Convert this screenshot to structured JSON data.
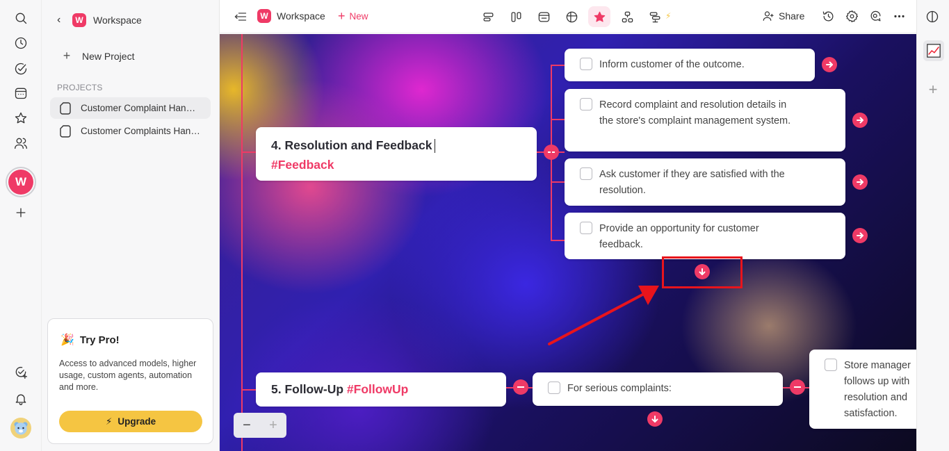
{
  "sidebar": {
    "workspace_name": "Workspace",
    "new_project_label": "New Project",
    "projects_heading": "PROJECTS",
    "projects": [
      {
        "name": "Customer Complaint Handling",
        "active": true
      },
      {
        "name": "Customer Complaints Handling",
        "active": false
      }
    ],
    "pro_card": {
      "title": "Try Pro!",
      "description": "Access to advanced models, higher usage, custom agents, automation and more.",
      "button_label": "Upgrade"
    }
  },
  "rail": {
    "workspace_avatar_letter": "W"
  },
  "topbar": {
    "workspace_name": "Workspace",
    "logo_letter": "W",
    "new_label": "New",
    "share_label": "Share"
  },
  "canvas": {
    "section4": {
      "title": "4. Resolution and Feedback",
      "tag": "#Feedback",
      "tasks": [
        "Inform customer of the outcome.",
        "Record complaint and resolution details in the store's complaint management system.",
        "Ask customer if they are satisfied with the resolution.",
        "Provide an opportunity for customer feedback."
      ]
    },
    "section5": {
      "title": "5. Follow-Up",
      "tag": "#FollowUp",
      "task": "For serious complaints:",
      "subtask": "Store manager follows up with resolution and satisfaction."
    },
    "zoom_out_label": "−",
    "zoom_in_label": "+"
  },
  "colors": {
    "accent": "#ef3a66",
    "highlight_box": "#e8141c",
    "upgrade": "#f5c542"
  }
}
